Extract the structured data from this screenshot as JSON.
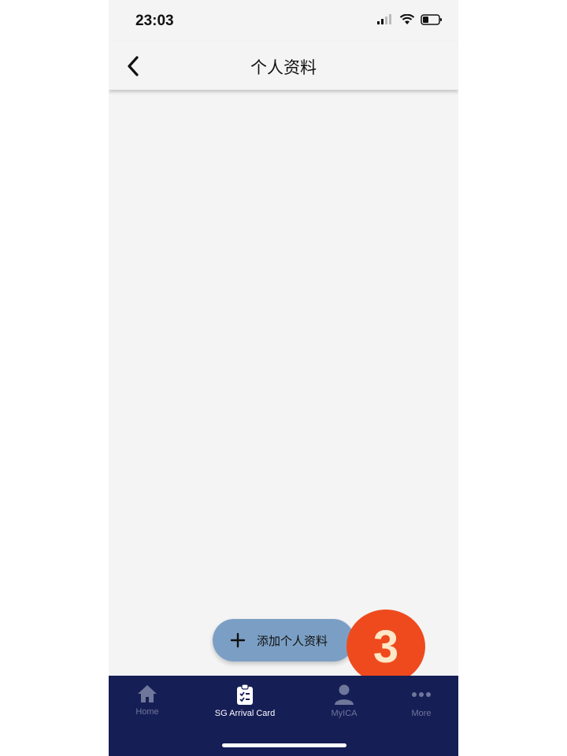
{
  "status_bar": {
    "time": "23:03"
  },
  "header": {
    "title": "个人资料"
  },
  "fab": {
    "label": "添加个人资料"
  },
  "badge": {
    "number": "3"
  },
  "tabbar": {
    "items": [
      {
        "label": "Home",
        "icon": "home-icon",
        "active": false
      },
      {
        "label": "SG Arrival Card",
        "icon": "clipboard-icon",
        "active": true
      },
      {
        "label": "MyICA",
        "icon": "person-icon",
        "active": false
      },
      {
        "label": "More",
        "icon": "more-dots-icon",
        "active": false
      }
    ]
  },
  "colors": {
    "background": "#f4f4f4",
    "tabbar": "#161e56",
    "fab": "#7b9fc4",
    "badge": "#ef4a1d",
    "inactive_tab": "#6f779b"
  }
}
